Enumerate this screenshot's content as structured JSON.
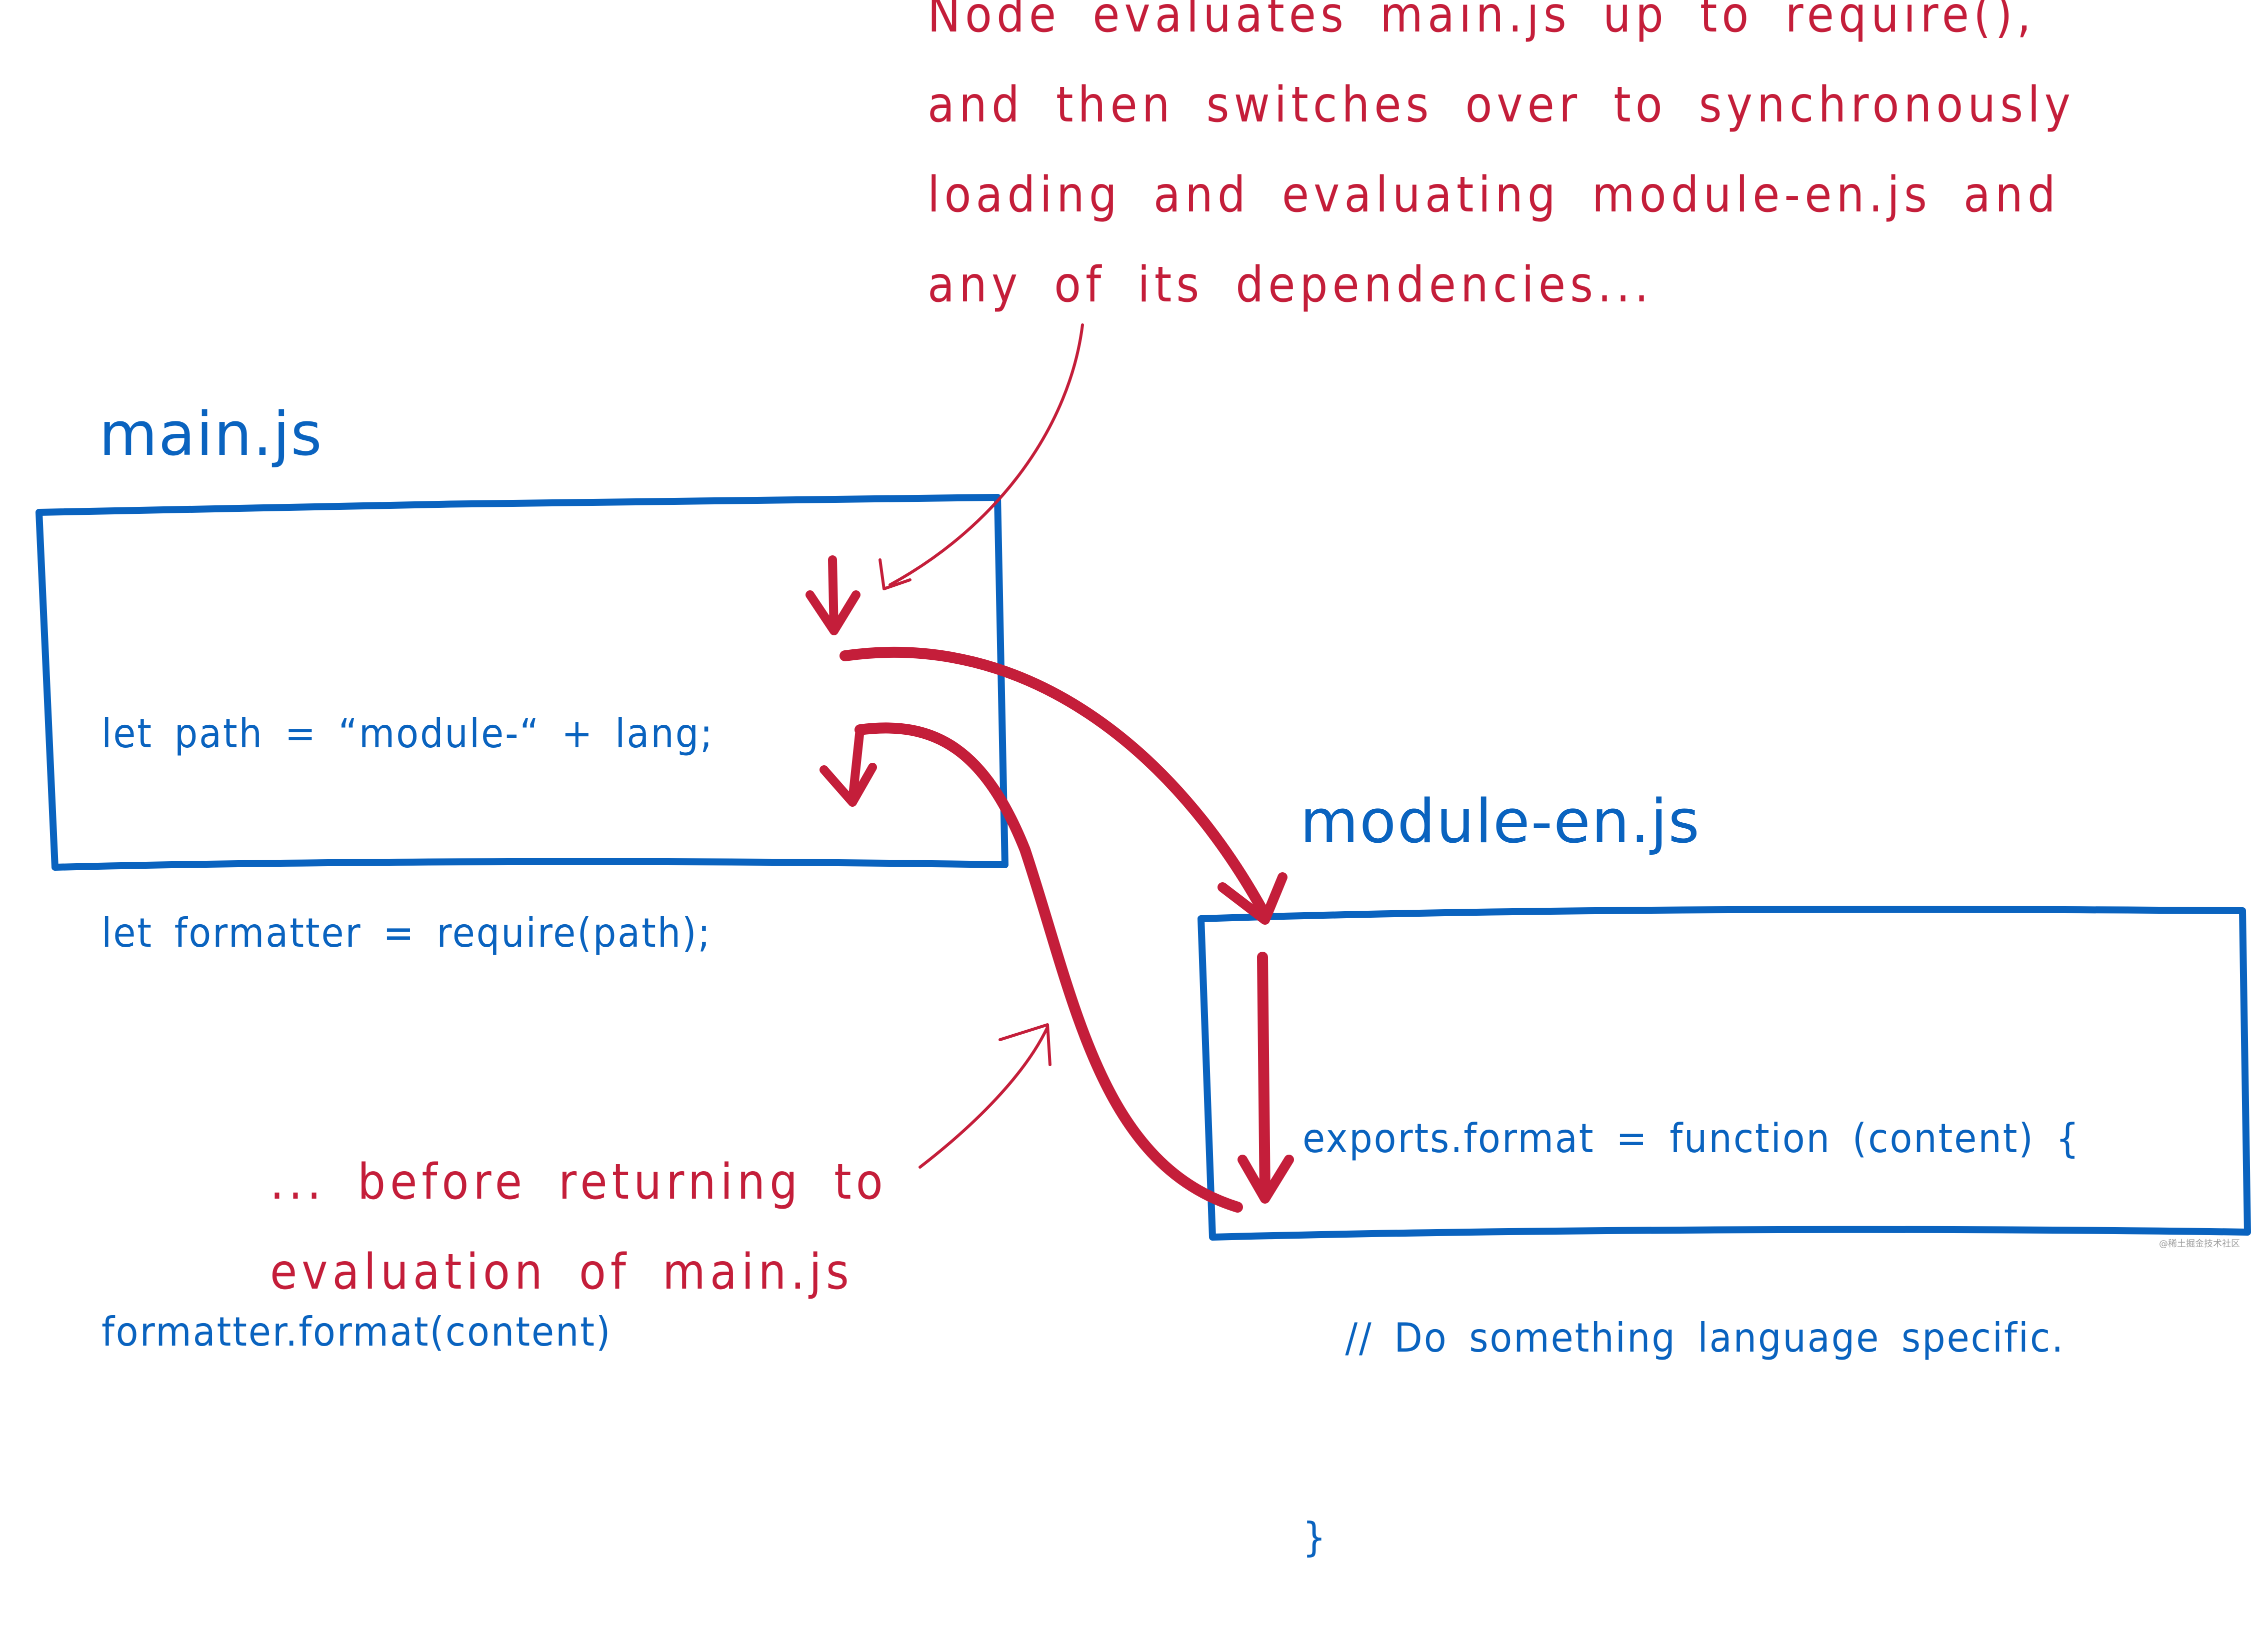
{
  "top_note": {
    "lines": [
      "Node evaluates main.js up to require(),",
      "and then switches over to synchronously",
      "loading and evaluating module-en.js and",
      "any of its dependencies..."
    ]
  },
  "bottom_note": {
    "lines": [
      "... before returning to",
      "evaluation of main.js"
    ]
  },
  "main_module": {
    "title": "main.js",
    "code_lines": [
      "let path = “module-“ + lang;",
      "let formatter = require(path);",
      "",
      "formatter.format(content)"
    ]
  },
  "dependency_module": {
    "title": "module-en.js",
    "code_lines": [
      "exports.format = function (content) {",
      "  // Do something language specific.",
      "}"
    ]
  },
  "watermark": "@稀土掘金技术社区",
  "colors": {
    "annotation": "#c41e3a",
    "code": "#0a63bf",
    "background": "#ffffff"
  }
}
